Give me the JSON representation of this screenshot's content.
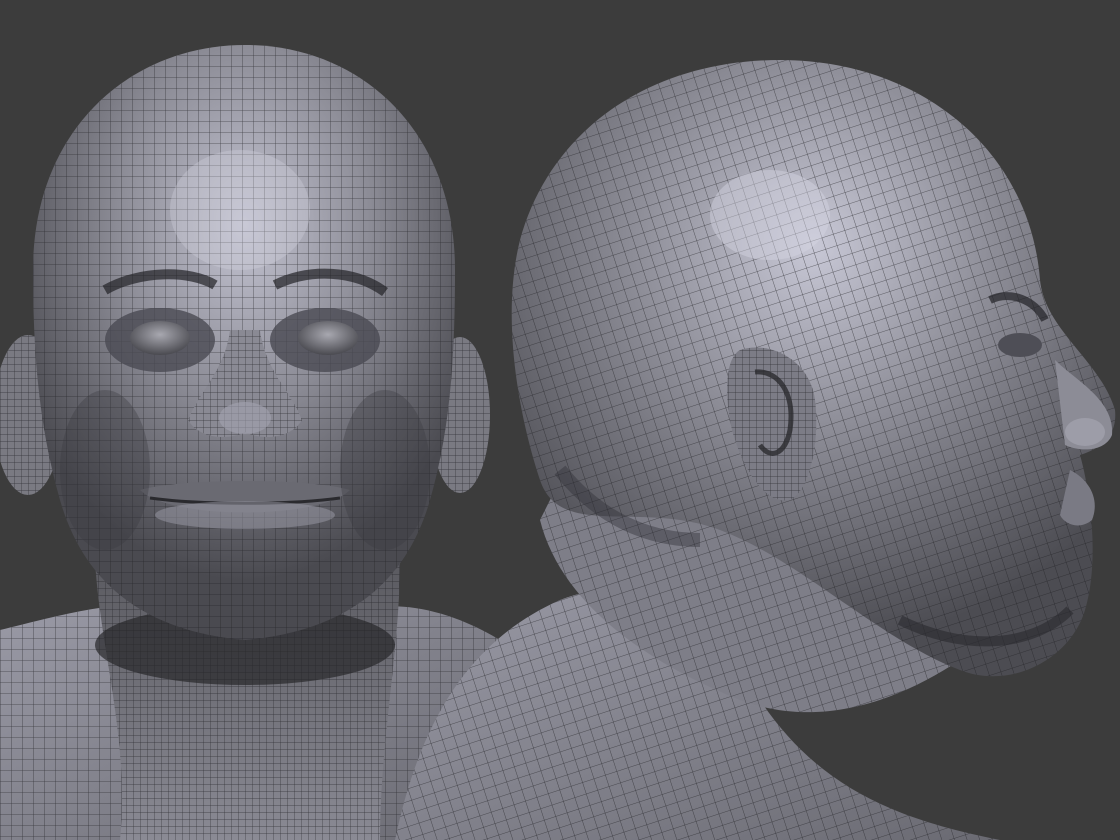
{
  "scene": {
    "background_color": "#3c3c3c",
    "mesh_base_color": "#8e8e96",
    "mesh_highlight_color": "#c8c8d6",
    "mesh_shadow_color": "#2a2a2e",
    "wire_color": "#1e1e22",
    "views": [
      {
        "name": "front-view",
        "description_type": "head-front"
      },
      {
        "name": "side-view",
        "description_type": "head-profile-right"
      }
    ]
  }
}
